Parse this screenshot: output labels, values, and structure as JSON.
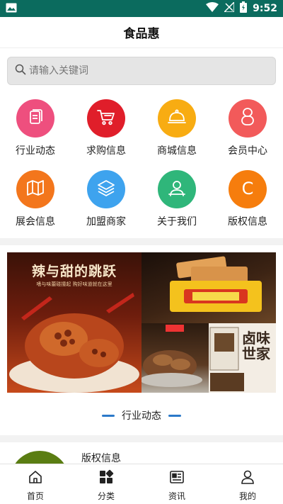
{
  "status_bar": {
    "time": "9:52",
    "left_icon": "image-icon",
    "right_icons": [
      "wifi-icon",
      "signal-icon",
      "battery-charging-icon"
    ]
  },
  "header": {
    "title": "食品惠"
  },
  "search": {
    "placeholder": "请输入关键词",
    "value": ""
  },
  "categories": [
    {
      "label": "行业动态",
      "icon": "document-icon",
      "color": "#ee4f7e"
    },
    {
      "label": "求购信息",
      "icon": "cart-icon",
      "color": "#e01e2a"
    },
    {
      "label": "商城信息",
      "icon": "service-bell-icon",
      "color": "#f8ac12"
    },
    {
      "label": "会员中心",
      "icon": "member-icon",
      "color": "#f25a5a"
    },
    {
      "label": "展会信息",
      "icon": "map-icon",
      "color": "#f3761c"
    },
    {
      "label": "加盟商家",
      "icon": "layers-icon",
      "color": "#3ea3ee"
    },
    {
      "label": "关于我们",
      "icon": "user-icon",
      "color": "#2fb67a"
    },
    {
      "label": "版权信息",
      "icon": "copyright-icon",
      "color": "#f67d0d"
    }
  ],
  "banner": {
    "left_title": "辣与甜的跳跃",
    "left_subtitle": "嗜与味蕾碰撞起 购好味道就在这里",
    "brand_text": "卤味世家"
  },
  "section": {
    "title": "行业动态"
  },
  "card": {
    "title": "版权信息"
  },
  "tabbar": [
    {
      "label": "首页",
      "icon": "home-icon"
    },
    {
      "label": "分类",
      "icon": "category-icon"
    },
    {
      "label": "资讯",
      "icon": "news-icon"
    },
    {
      "label": "我的",
      "icon": "profile-icon"
    }
  ],
  "colors": {
    "status_bar": "#0b6b5e",
    "accent_blue": "#2b79c9"
  }
}
